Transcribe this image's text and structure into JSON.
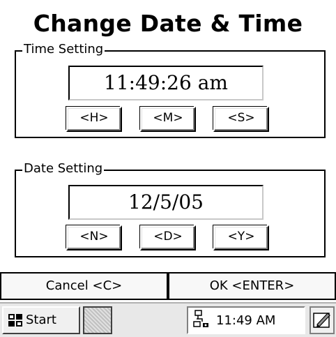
{
  "title": "Change Date & Time",
  "time_group": {
    "legend": "Time Setting",
    "value": "11:49:26 am",
    "buttons": [
      "<H>",
      "<M>",
      "<S>"
    ]
  },
  "date_group": {
    "legend": "Date Setting",
    "value": "12/5/05",
    "buttons": [
      "<N>",
      "<D>",
      "<Y>"
    ]
  },
  "actions": {
    "cancel_label": "Cancel <C>",
    "ok_label": "OK <ENTER>"
  },
  "taskbar": {
    "start_label": "Start",
    "start_icon": "windows-flag-icon",
    "clock": "11:49 AM",
    "network_icon": "network-connection-icon",
    "input_icon": "pen-input-icon"
  }
}
